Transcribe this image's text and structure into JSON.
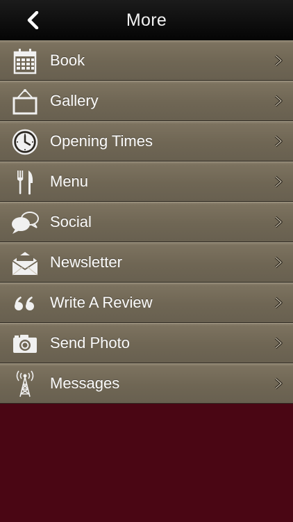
{
  "header": {
    "title": "More",
    "back_icon": "back-chevron-icon"
  },
  "menu": {
    "items": [
      {
        "label": "Book",
        "icon": "calendar-icon"
      },
      {
        "label": "Gallery",
        "icon": "picture-frame-icon"
      },
      {
        "label": "Opening Times",
        "icon": "clock-icon"
      },
      {
        "label": "Menu",
        "icon": "fork-knife-icon"
      },
      {
        "label": "Social",
        "icon": "speech-bubbles-icon"
      },
      {
        "label": "Newsletter",
        "icon": "envelope-icon"
      },
      {
        "label": "Write A Review",
        "icon": "quote-icon"
      },
      {
        "label": "Send Photo",
        "icon": "camera-icon"
      },
      {
        "label": "Messages",
        "icon": "antenna-icon"
      }
    ]
  },
  "colors": {
    "nav_bar": "#0b0b0b",
    "menu_item": "#6f6654",
    "background": "#4a0614",
    "text": "#fbfbfb"
  }
}
